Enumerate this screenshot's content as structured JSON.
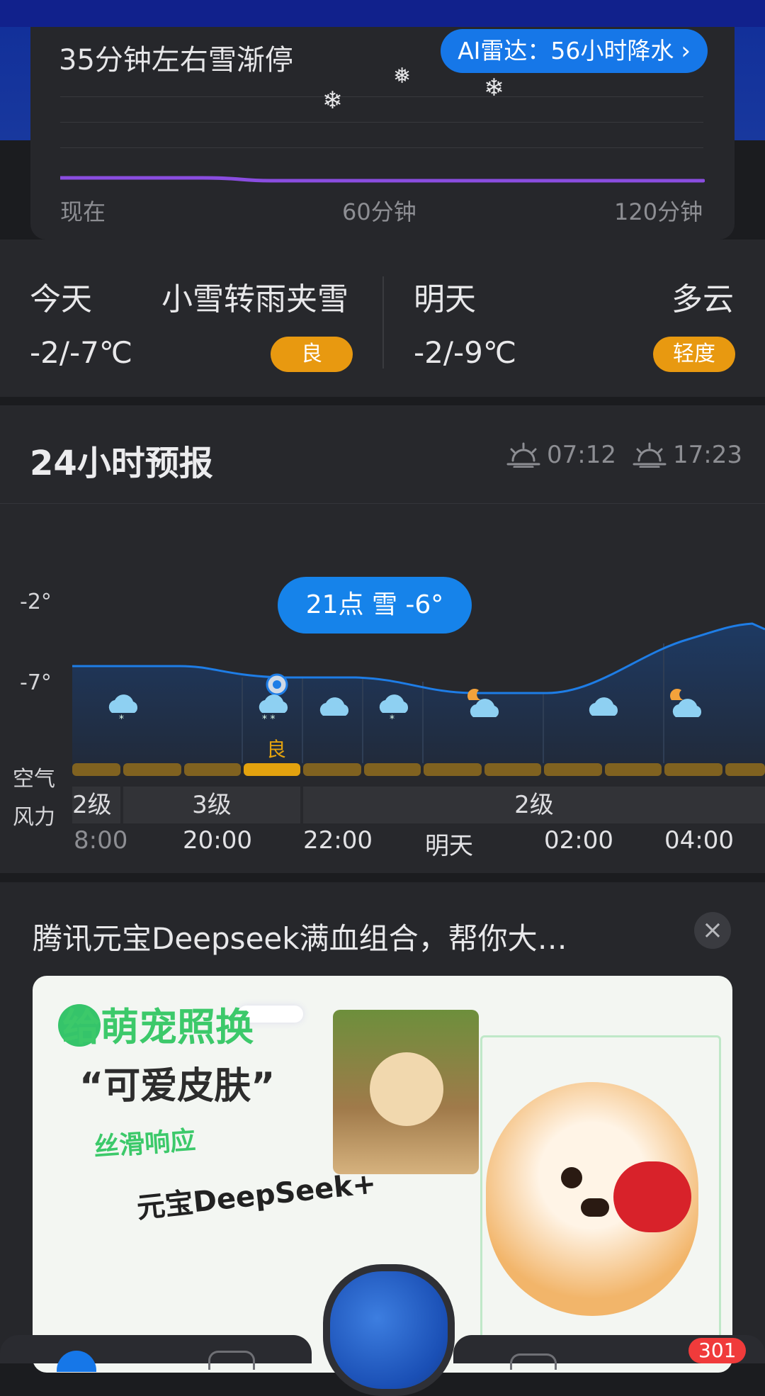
{
  "colors": {
    "accent": "#1677e8",
    "aqi_good": "#e89910",
    "snow_line": "#8a4de0",
    "temp_line": "#1e7de6",
    "badge": "#f03b3b"
  },
  "precip_card": {
    "title": "35分钟左右雪渐停",
    "radar_button": "AI雷达：56小时降水",
    "axis": [
      "现在",
      "60分钟",
      "120分钟"
    ],
    "icons": [
      "snowflake-icon",
      "snowflake-icon",
      "snowflake-icon"
    ]
  },
  "today": {
    "label": "今天",
    "condition": "小雪转雨夹雪",
    "temp": "-2/-7℃",
    "aqi": "良"
  },
  "tomorrow": {
    "label": "明天",
    "condition": "多云",
    "temp": "-2/-9℃",
    "aqi": "轻度"
  },
  "forecast": {
    "title": "24小时预报",
    "sunrise": "07:12",
    "sunset": "17:23",
    "y_labels": [
      "-2°",
      "-7°"
    ],
    "tooltip": "21点 雪 -6°",
    "aqi_label": "良",
    "row_labels": {
      "air": "空气",
      "wind": "风力"
    },
    "wind": [
      "2级",
      "3级",
      "2级"
    ],
    "times": [
      "8:00",
      "20:00",
      "22:00",
      "明天",
      "02:00",
      "04:00"
    ],
    "weather_icons": [
      "light-snow-icon",
      "light-snow-icon",
      "cloudy-icon",
      "light-snow-icon",
      "partly-cloudy-night-icon",
      "cloudy-icon",
      "partly-cloudy-night-icon"
    ]
  },
  "ad": {
    "title": "腾讯元宝Deepseek满血组合，帮你大…",
    "headline": "给萌宠照换",
    "quote": "“可爱皮肤”",
    "tagline": "丝滑响应",
    "brand": "元宝DeepSeek+"
  },
  "nav": {
    "badge": "301"
  }
}
